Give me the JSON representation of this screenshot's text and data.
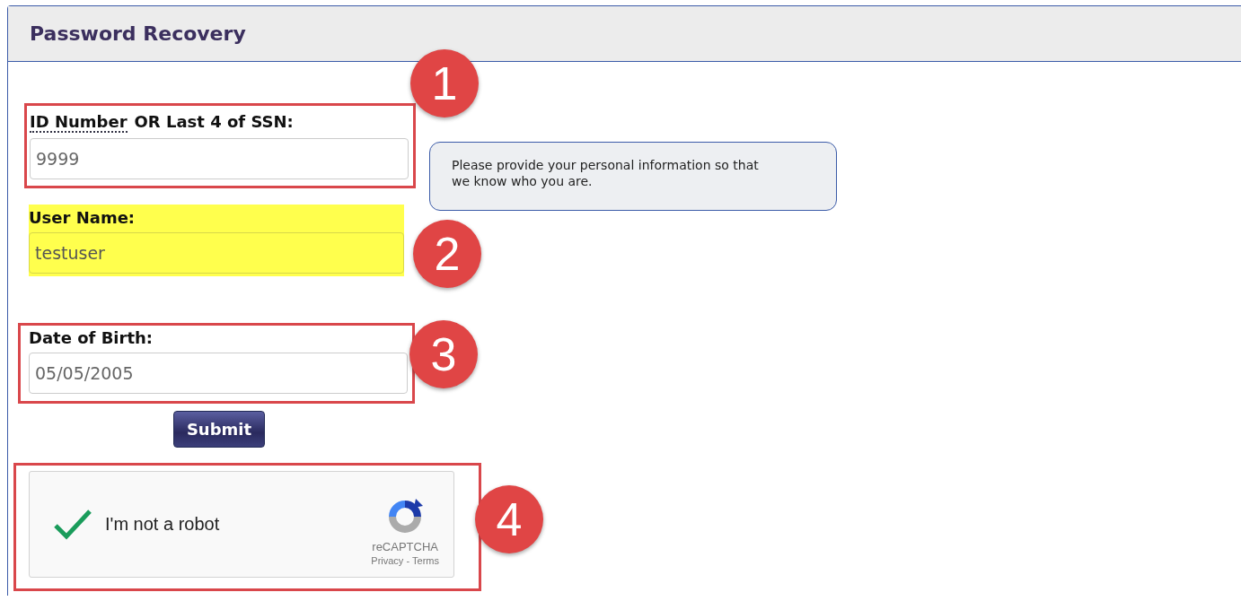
{
  "panel": {
    "title": "Password Recovery"
  },
  "fields": [
    {
      "abbr": "ID Number",
      "label": "OR Last 4 of SSN:",
      "value": "9999",
      "outlined": true,
      "highlighted": false,
      "annotation": "1"
    },
    {
      "label": "User Name:",
      "value": "testuser",
      "outlined": false,
      "highlighted": true,
      "annotation": "2"
    },
    {
      "label": "Date of Birth:",
      "value": "05/05/2005",
      "outlined": true,
      "highlighted": false,
      "annotation": "3"
    }
  ],
  "tooltip": "Please provide your personal information so that we know who you are.",
  "submit": "Submit",
  "captcha": {
    "label": "I'm not a robot",
    "checked": true,
    "brand": "reCAPTCHA",
    "privacy": "Privacy",
    "separator": "-",
    "terms": "Terms",
    "outlined": true,
    "annotation": "4"
  }
}
